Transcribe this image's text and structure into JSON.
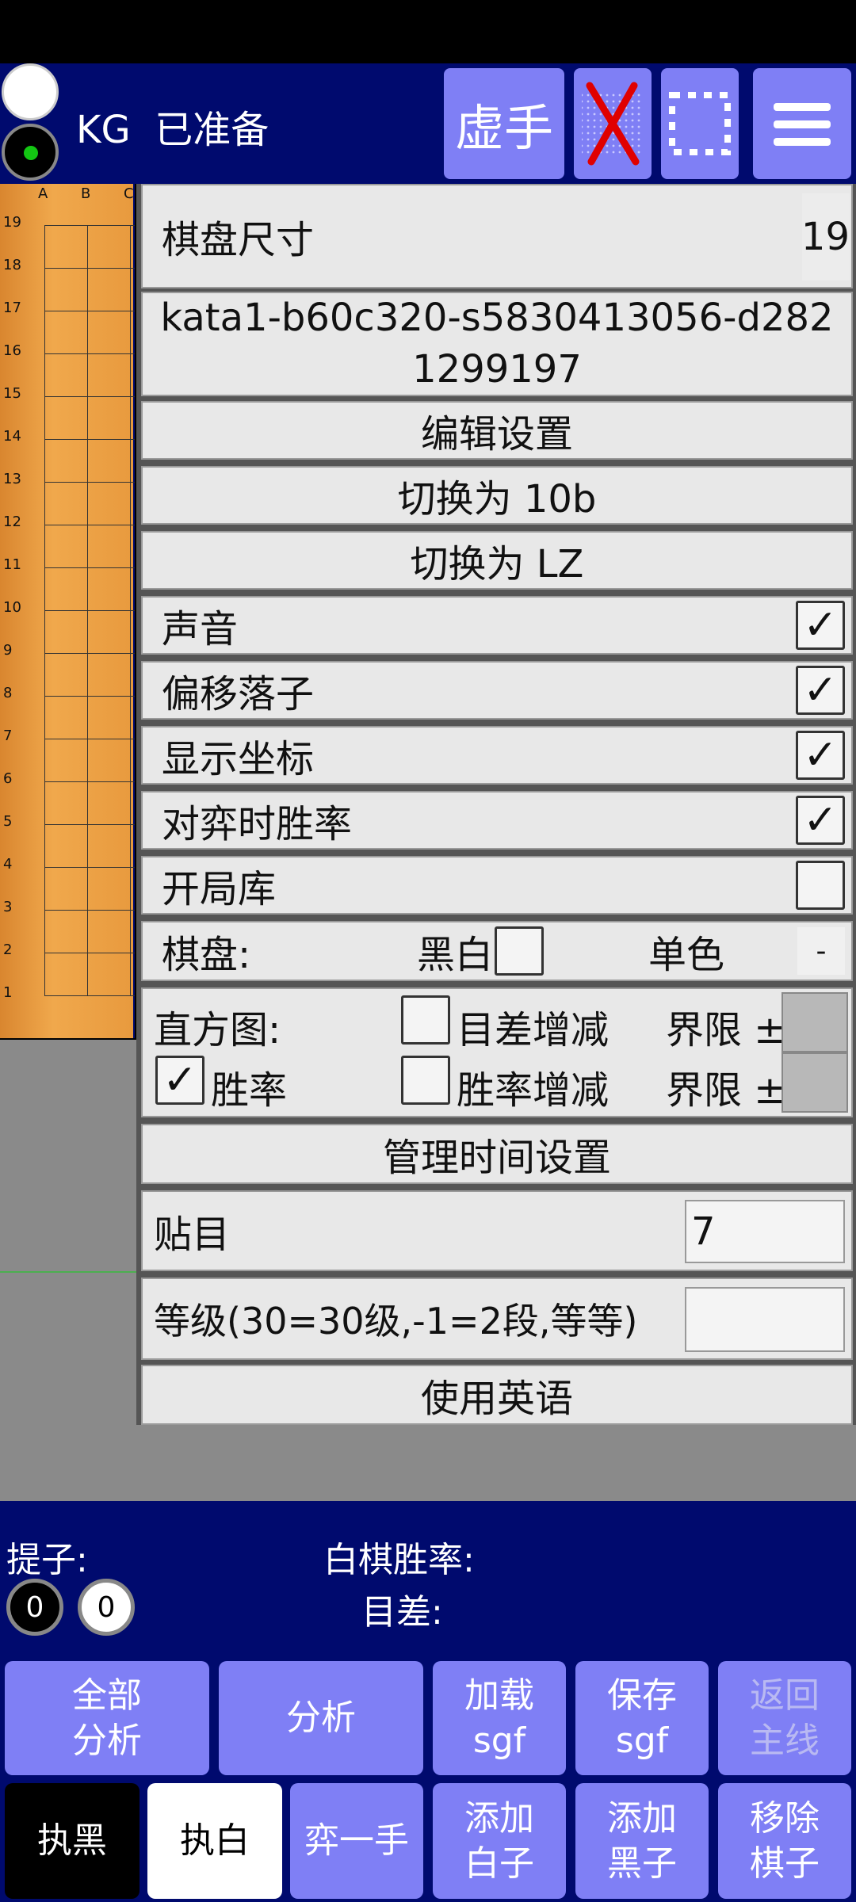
{
  "top": {
    "status_text": "KG  已准备",
    "virtual_move_label": "虚手"
  },
  "board": {
    "columns": [
      "A",
      "B",
      "C"
    ],
    "rows": [
      "19",
      "18",
      "17",
      "16",
      "15",
      "14",
      "13",
      "12",
      "11",
      "10",
      "9",
      "8",
      "7",
      "6",
      "5",
      "4",
      "3",
      "2",
      "1"
    ]
  },
  "settings": {
    "board_size_label": "棋盘尺寸",
    "board_size_value": "19",
    "network_name": "kata1-b60c320-s5830413056-d2821299197",
    "edit_settings": "编辑设置",
    "switch_10b": "切换为 10b",
    "switch_lz": "切换为 LZ",
    "sound_label": "声音",
    "sound_checked": true,
    "offset_label": "偏移落子",
    "offset_checked": true,
    "coords_label": "显示坐标",
    "coords_checked": true,
    "winrate_label": "对弈时胜率",
    "winrate_checked": true,
    "opening_label": "开局库",
    "opening_checked": false,
    "board_label": "棋盘:",
    "bw_label": "黑白",
    "mono_label": "单色",
    "mono_value": "-",
    "histogram_label": "直方图:",
    "score_delta_label": "目差增减",
    "limit_label_1": "界限 ±",
    "winrate_hist_label": "胜率",
    "winrate_hist_checked": true,
    "winrate_delta_label": "胜率增减",
    "limit_label_2": "界限 ±",
    "manage_time": "管理时间设置",
    "komi_label": "贴目",
    "komi_value": "7",
    "rank_label": "等级(30=30级,-1=2段,等等)",
    "rank_value": "",
    "use_english": "使用英语"
  },
  "bottom": {
    "captures_label": "提子:",
    "black_captures": "0",
    "white_captures": "0",
    "white_winrate_label": "白棋胜率:",
    "score_label": "目差:",
    "buttons_row1": [
      {
        "l1": "全部",
        "l2": "分析"
      },
      {
        "l1": "分析",
        "l2": ""
      },
      {
        "l1": "加载",
        "l2": "sgf"
      },
      {
        "l1": "保存",
        "l2": "sgf"
      },
      {
        "l1": "返回",
        "l2": "主线"
      }
    ],
    "buttons_row2": [
      {
        "l1": "执黑",
        "l2": ""
      },
      {
        "l1": "执白",
        "l2": ""
      },
      {
        "l1": "弈一手",
        "l2": ""
      },
      {
        "l1": "添加",
        "l2": "白子"
      },
      {
        "l1": "添加",
        "l2": "黑子"
      },
      {
        "l1": "移除",
        "l2": "棋子"
      }
    ]
  },
  "colors": {
    "navy": "#000a6e",
    "button": "#7f7ff5",
    "panel_row": "#e8e8e8"
  }
}
